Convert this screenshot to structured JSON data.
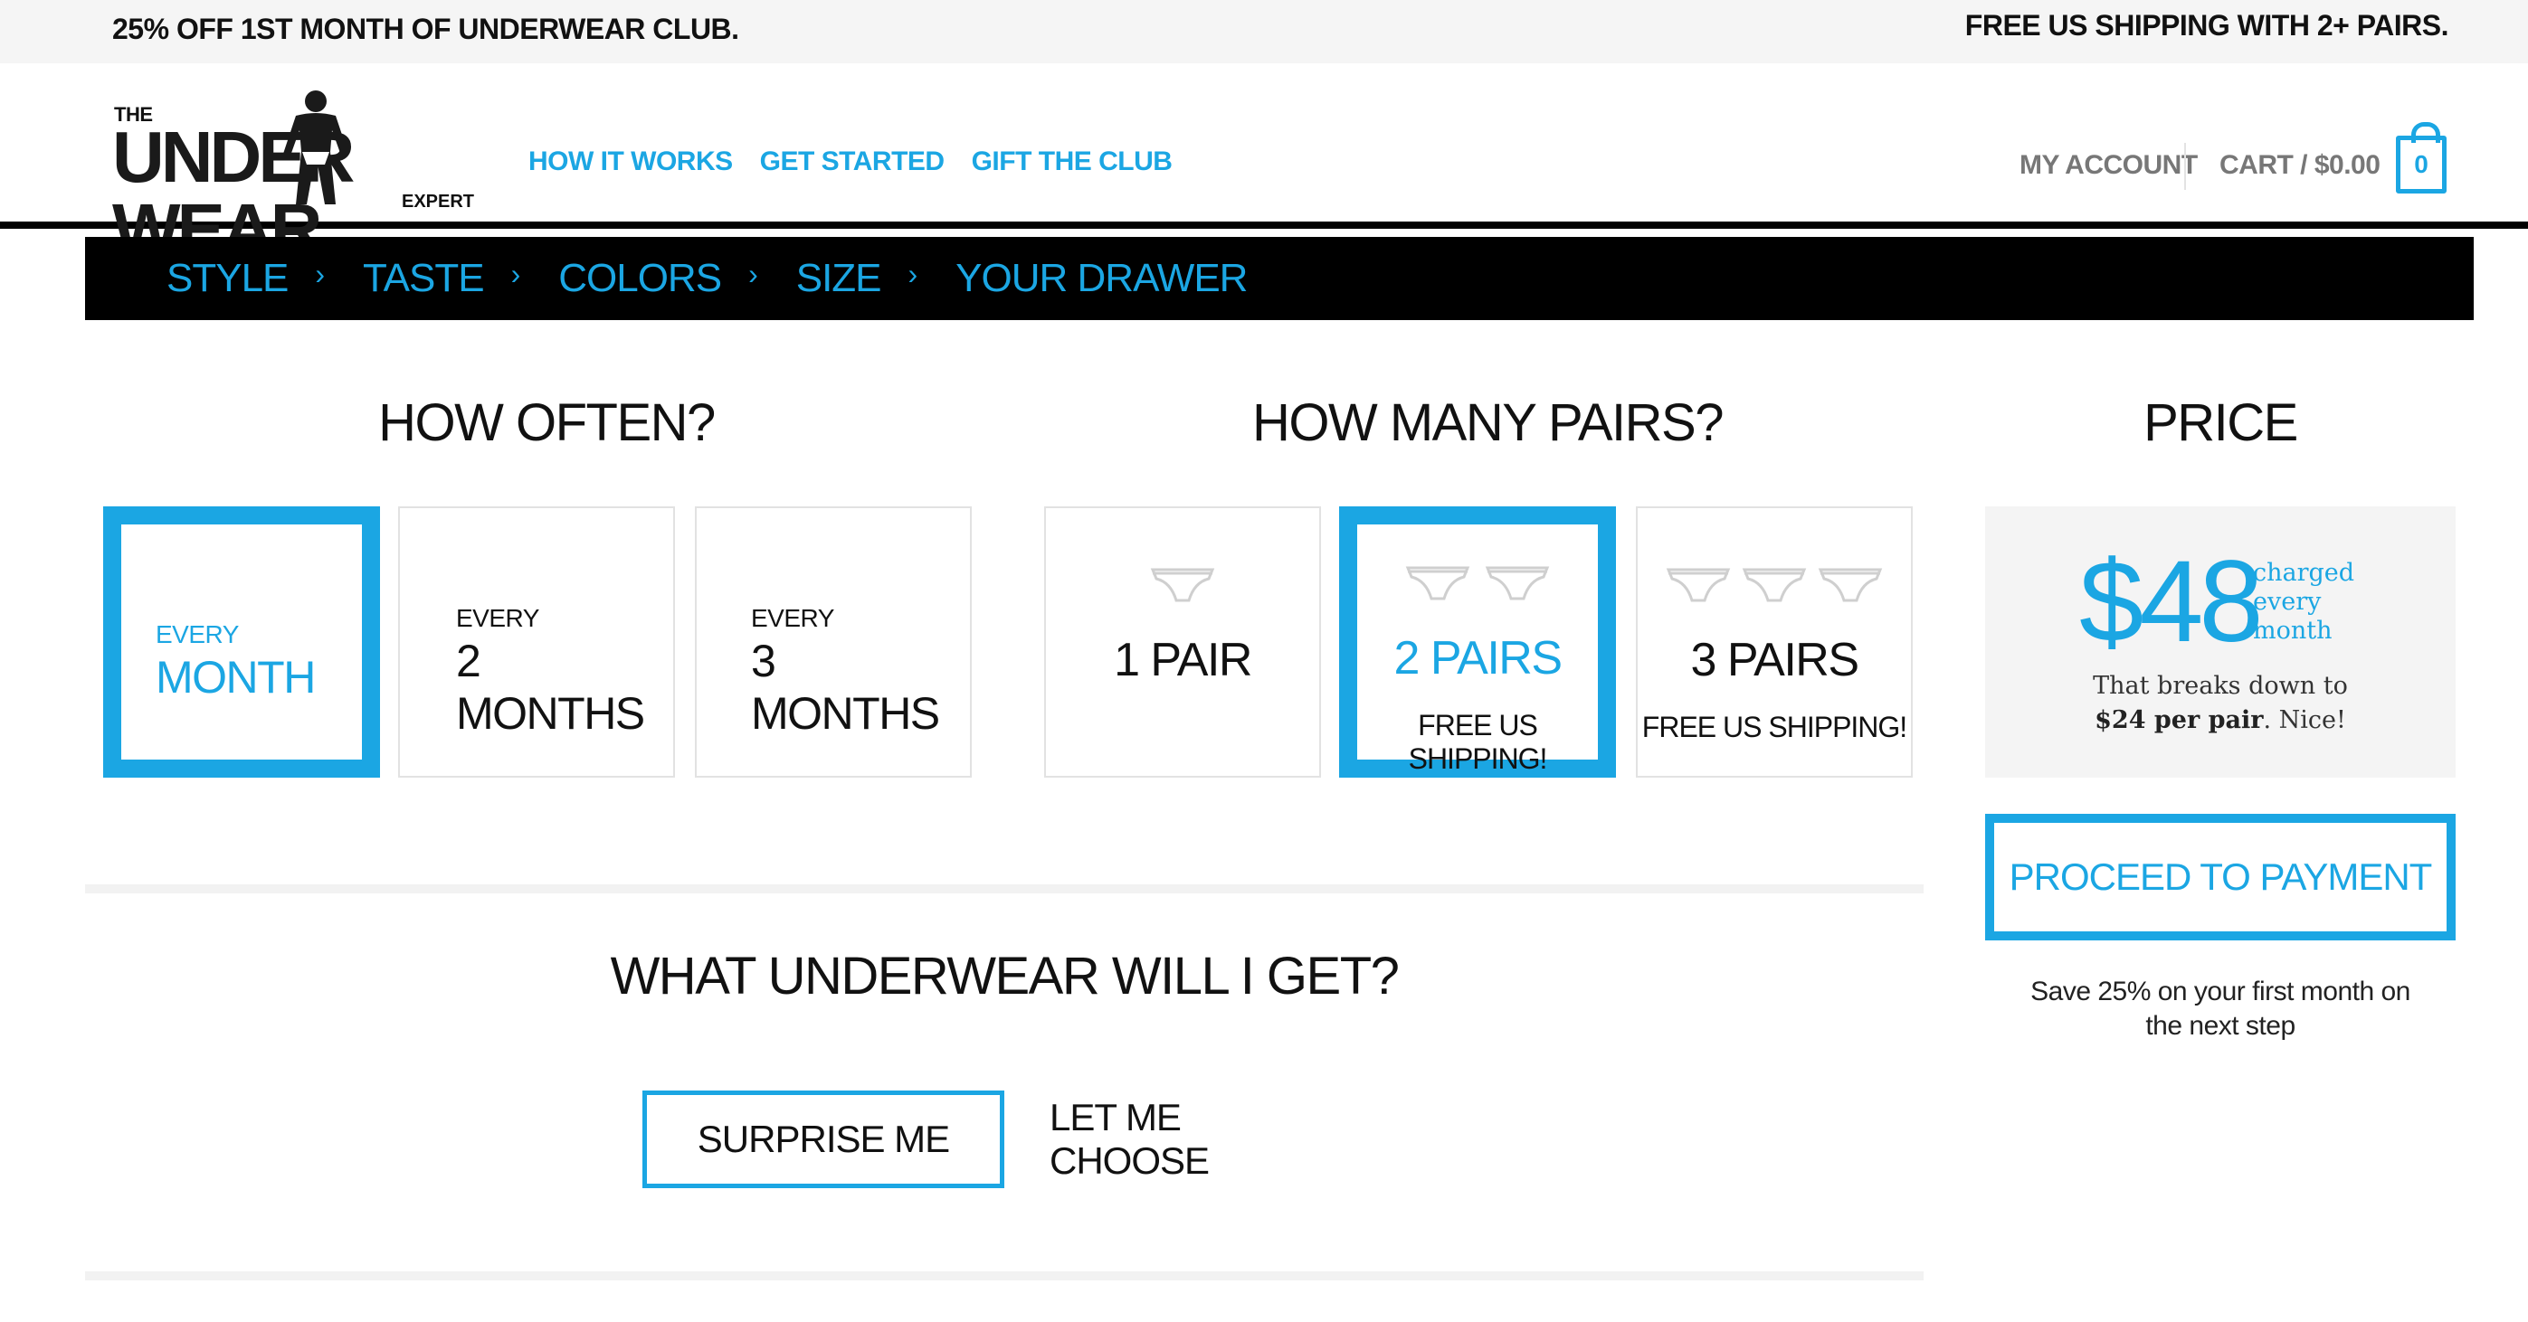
{
  "promo": {
    "left_text": "25% OFF 1ST MONTH OF UNDERWEAR CLUB.",
    "right_text": "FREE US SHIPPING WITH 2+ PAIRS."
  },
  "logo": {
    "line1": "THE",
    "line2a": "UNDER",
    "line2b": "WEAR",
    "line3": "EXPERT"
  },
  "nav": {
    "items": [
      "HOW IT WORKS",
      "GET STARTED",
      "GIFT THE CLUB"
    ],
    "account": "MY ACCOUNT",
    "cart": "CART / $0.00",
    "cart_count": "0"
  },
  "steps": [
    "STYLE",
    "TASTE",
    "COLORS",
    "SIZE",
    "YOUR DRAWER"
  ],
  "often": {
    "title": "HOW OFTEN?",
    "options": [
      {
        "small": "EVERY",
        "big": "MONTH",
        "selected": true
      },
      {
        "small": "EVERY",
        "big": "2 MONTHS",
        "selected": false
      },
      {
        "small": "EVERY",
        "big": "3 MONTHS",
        "selected": false
      }
    ]
  },
  "pairs": {
    "title": "HOW MANY PAIRS?",
    "options": [
      {
        "label": "1 PAIR",
        "note": "",
        "icons": 1,
        "selected": false
      },
      {
        "label": "2 PAIRS",
        "note": "FREE US SHIPPING!",
        "icons": 2,
        "selected": true
      },
      {
        "label": "3 PAIRS",
        "note": "FREE US SHIPPING!",
        "icons": 3,
        "selected": false
      }
    ],
    "icon_name": "briefs-icon"
  },
  "price": {
    "title": "PRICE",
    "amount": "$48",
    "frequency_line1": "charged",
    "frequency_line2": "every",
    "frequency_line3": "month",
    "breakdown_prefix": "That breaks down to",
    "breakdown_value": "$24 per pair",
    "breakdown_suffix": ". Nice!",
    "proceed_label": "PROCEED TO PAYMENT",
    "save_note_line1": "Save 25% on your first month on",
    "save_note_line2": "the next step"
  },
  "underwear": {
    "title": "WHAT UNDERWEAR WILL I GET?",
    "surprise_label": "SURPRISE ME",
    "choose_label": "LET ME CHOOSE"
  },
  "colors": {
    "accent": "#1ba6e3",
    "black": "#000000",
    "light_gray": "#f4f4f4"
  }
}
